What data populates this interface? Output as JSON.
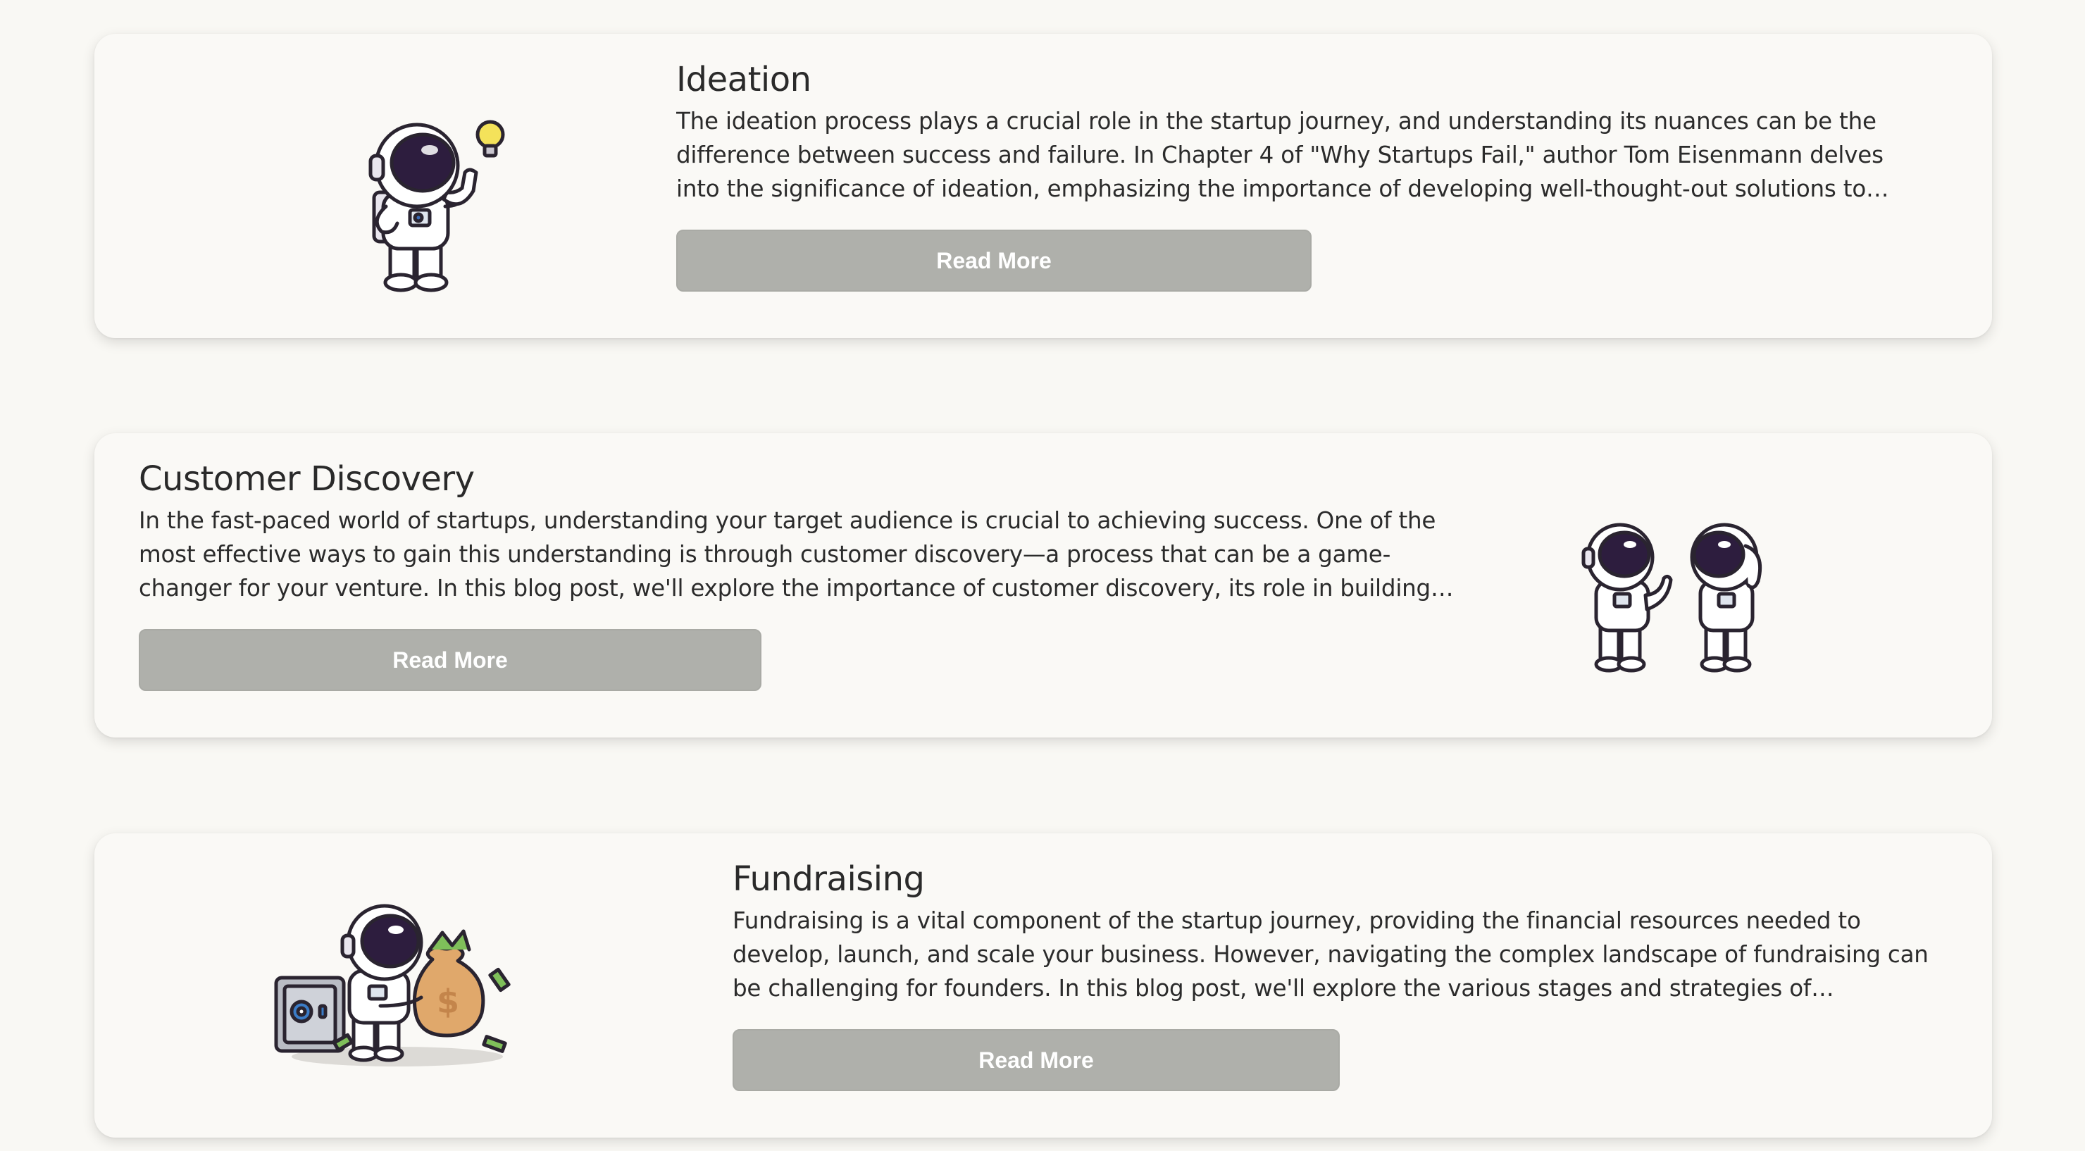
{
  "posts": [
    {
      "title": "Ideation",
      "excerpt": "The ideation process plays a crucial role in the startup journey, and understanding its nuances can be the difference between success and failure. In Chapter 4 of \"Why Startups Fail,\" author Tom Eisenmann delves into the significance of ideation, emphasizing the importance of developing well-thought-out solutions to identified problems.",
      "button_label": "Read More",
      "illustration": "astronaut-lightbulb-illustration"
    },
    {
      "title": "Customer Discovery",
      "excerpt": "In the fast-paced world of startups, understanding your target audience is crucial to achieving success. One of the most effective ways to gain this understanding is through customer discovery—a process that can be a game-changer for your venture. In this blog post, we'll explore the importance of customer discovery, its role in building products.",
      "button_label": "Read More",
      "illustration": "two-astronauts-illustration"
    },
    {
      "title": "Fundraising",
      "excerpt": "Fundraising is a vital component of the startup journey, providing the financial resources needed to develop, launch, and scale your business. However, navigating the complex landscape of fundraising can be challenging for founders. In this blog post, we'll explore the various stages and strategies of fundraising, from pre-seed to Series A.",
      "button_label": "Read More",
      "illustration": "astronaut-money-bag-safe-illustration"
    }
  ],
  "colors": {
    "page_background": "#f9f8f4",
    "card_background": "#faf9f6",
    "button_background": "#afb0ab",
    "button_text": "#ffffff",
    "helmet_visor": "#2d1d3e",
    "bulb": "#f4e25a",
    "money_bag": "#e0a86b"
  }
}
